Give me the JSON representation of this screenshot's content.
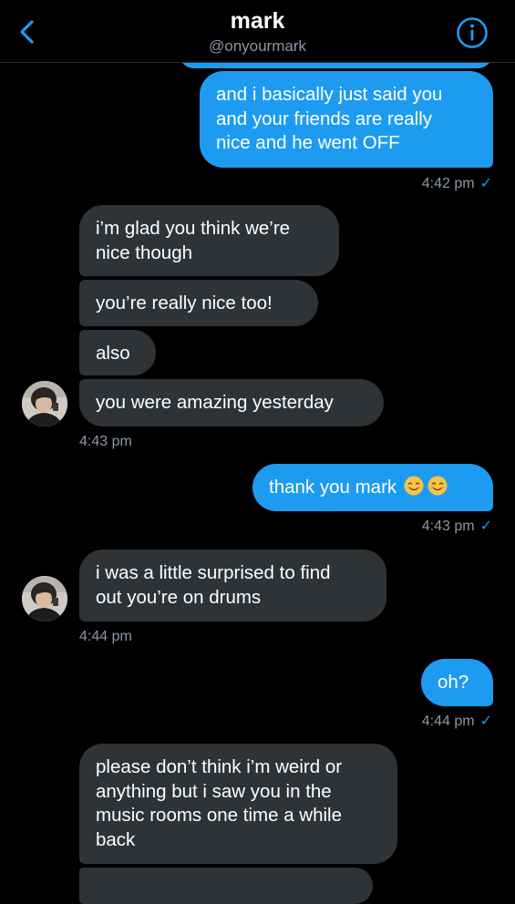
{
  "header": {
    "title": "mark",
    "handle": "@onyourmark"
  },
  "colors": {
    "outgoing": "#1d9bf0",
    "incoming": "#2f3336",
    "background": "#000000",
    "muted": "#8b98a5"
  },
  "icons": {
    "back": "chevron-left-icon",
    "info": "info-circle-icon",
    "emoji": "smiling-face-icon",
    "check": "checkmark-icon"
  },
  "messages": {
    "m1": {
      "lines": [
        "and i basically just said you",
        "and your friends are really",
        "nice and he went OFF"
      ]
    },
    "t1": {
      "time": "4:42 pm",
      "check": "✓"
    },
    "m2": {
      "lines": [
        "i’m glad you think we’re",
        "nice though"
      ]
    },
    "m3": {
      "text": "you’re really nice too!"
    },
    "m4": {
      "text": "also"
    },
    "m5": {
      "text": "you were amazing yesterday"
    },
    "t2": {
      "time": "4:43 pm"
    },
    "m6": {
      "text": "thank you mark"
    },
    "t3": {
      "time": "4:43 pm",
      "check": "✓"
    },
    "m7": {
      "lines": [
        "i was a little surprised to find",
        "out you’re on drums"
      ]
    },
    "t4": {
      "time": "4:44 pm"
    },
    "m8": {
      "text": "oh?"
    },
    "t5": {
      "time": "4:44 pm",
      "check": "✓"
    },
    "m9": {
      "lines": [
        "please don’t think i’m weird or",
        "anything but i saw you in the",
        "music rooms one time a while",
        "back"
      ]
    }
  }
}
